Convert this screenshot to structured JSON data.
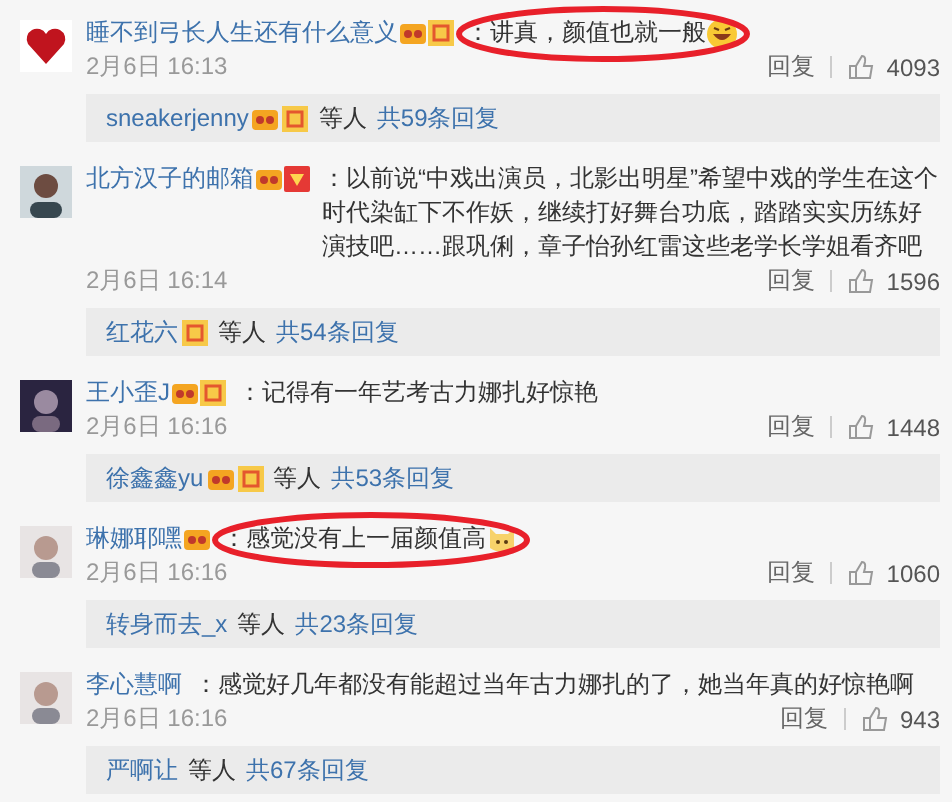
{
  "comments": [
    {
      "avatar": {
        "kind": "picture"
      },
      "user": "睡不到弓长人生还有什么意义",
      "badges": [
        {
          "kind": "vip"
        },
        {
          "kind": "gold"
        }
      ],
      "text": "：讲真，颜值也就一般",
      "emoji": {
        "kind": "laugh"
      },
      "highlighted": true,
      "time": "2月6日 16:13",
      "reply_label": "回复",
      "likes": "4093",
      "reply_thread": {
        "user": "sneakerjenny",
        "badges": [
          {
            "kind": "vip"
          },
          {
            "kind": "gold"
          }
        ],
        "others": "等人",
        "count": "共59条回复"
      }
    },
    {
      "avatar": {
        "kind": "picture"
      },
      "user": "北方汉子的邮箱",
      "badges": [
        {
          "kind": "vip"
        },
        {
          "kind": "red"
        }
      ],
      "text": "：以前说“中戏出演员，北影出明星”希望中戏的学生在这个时代染缸下不作妖，继续打好舞台功底，踏踏实实历练好演技吧……跟巩俐，章子怡孙红雷这些老学长学姐看齐吧",
      "highlighted": false,
      "time": "2月6日 16:14",
      "reply_label": "回复",
      "likes": "1596",
      "reply_thread": {
        "user": "红花六",
        "badges": [
          {
            "kind": "gold"
          }
        ],
        "others": "等人",
        "count": "共54条回复"
      }
    },
    {
      "avatar": {
        "kind": "picture"
      },
      "user": "王小歪J",
      "badges": [
        {
          "kind": "vip"
        },
        {
          "kind": "gold"
        }
      ],
      "text": "：记得有一年艺考古力娜扎好惊艳",
      "highlighted": false,
      "time": "2月6日 16:16",
      "reply_label": "回复",
      "likes": "1448",
      "reply_thread": {
        "user": "徐鑫鑫yu",
        "badges": [
          {
            "kind": "vip"
          },
          {
            "kind": "gold"
          }
        ],
        "others": "等人",
        "count": "共53条回复"
      }
    },
    {
      "avatar": {
        "kind": "picture"
      },
      "user": "琳娜耶嘿",
      "badges": [
        {
          "kind": "vip"
        }
      ],
      "text": "：感觉没有上一届颜值高",
      "emoji": {
        "kind": "cat"
      },
      "highlighted": true,
      "time": "2月6日 16:16",
      "reply_label": "回复",
      "likes": "1060",
      "reply_thread": {
        "user": "转身而去_x",
        "others": "等人",
        "count": "共23条回复"
      }
    },
    {
      "avatar": {
        "kind": "picture"
      },
      "user": "李心慧啊",
      "text": "：感觉好几年都没有能超过当年古力娜扎的了，她当年真的好惊艳啊",
      "highlighted": false,
      "time": "2月6日 16:16",
      "reply_label": "回复",
      "likes": "943",
      "reply_thread": {
        "user": "严啊让",
        "others": "等人",
        "count": "共67条回复"
      }
    }
  ]
}
